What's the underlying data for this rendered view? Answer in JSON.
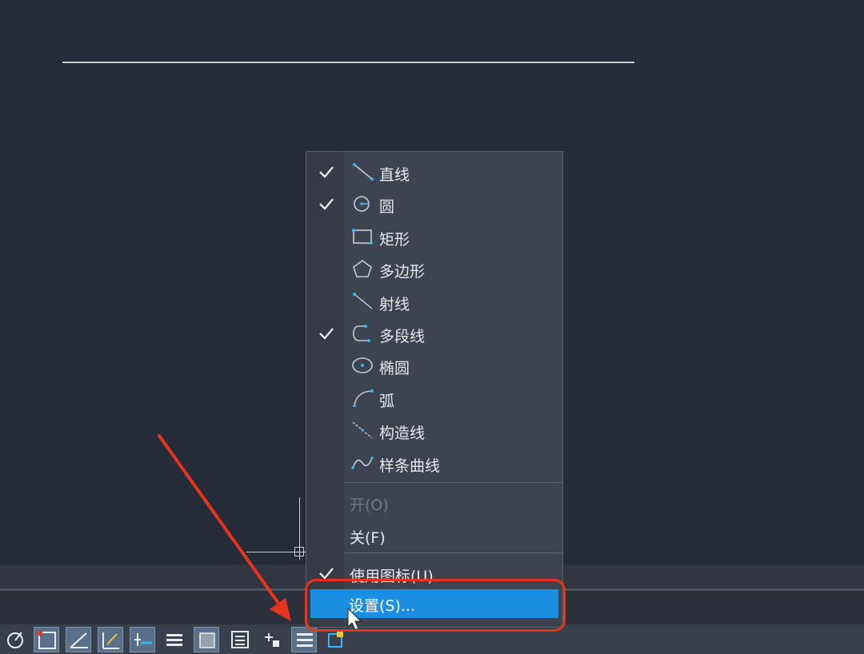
{
  "menu": {
    "items": [
      {
        "label": "直线",
        "checked": true,
        "icon": "line-icon"
      },
      {
        "label": "圆",
        "checked": true,
        "icon": "circle-icon"
      },
      {
        "label": "矩形",
        "checked": false,
        "icon": "rectangle-icon"
      },
      {
        "label": "多边形",
        "checked": false,
        "icon": "polygon-icon"
      },
      {
        "label": "射线",
        "checked": false,
        "icon": "ray-icon"
      },
      {
        "label": "多段线",
        "checked": true,
        "icon": "polyline-icon"
      },
      {
        "label": "椭圆",
        "checked": false,
        "icon": "ellipse-icon"
      },
      {
        "label": "弧",
        "checked": false,
        "icon": "arc-icon"
      },
      {
        "label": "构造线",
        "checked": false,
        "icon": "construction-line-icon"
      },
      {
        "label": "样条曲线",
        "checked": false,
        "icon": "spline-icon"
      }
    ],
    "on_label": "开(O)",
    "on_enabled": false,
    "off_label": "关(F)",
    "use_icons_label": "使用图标(U)",
    "use_icons_checked": true,
    "settings_label": "设置(S)..."
  },
  "statusbar": {
    "buttons": [
      {
        "name": "polar-tracking-icon",
        "on": false
      },
      {
        "name": "object-snap-icon",
        "on": true
      },
      {
        "name": "angle-icon",
        "on": true
      },
      {
        "name": "dynamic-input-icon",
        "on": true
      },
      {
        "name": "ortho-track-icon",
        "on": true
      },
      {
        "name": "lineweight-icon",
        "on": false
      },
      {
        "name": "transparency-icon",
        "on": true
      },
      {
        "name": "properties-list-icon",
        "on": false
      },
      {
        "name": "selection-cycling-icon",
        "on": false
      },
      {
        "name": "quick-draw-toolbar-icon",
        "on": true
      },
      {
        "name": "annotation-monitor-icon",
        "on": false
      }
    ]
  },
  "colors": {
    "canvas": "#262b38",
    "menu_bg": "#3d434f",
    "highlight": "#1d8fe3",
    "icon_accent": "#3cb4ef",
    "annotation": "#e8341f"
  }
}
